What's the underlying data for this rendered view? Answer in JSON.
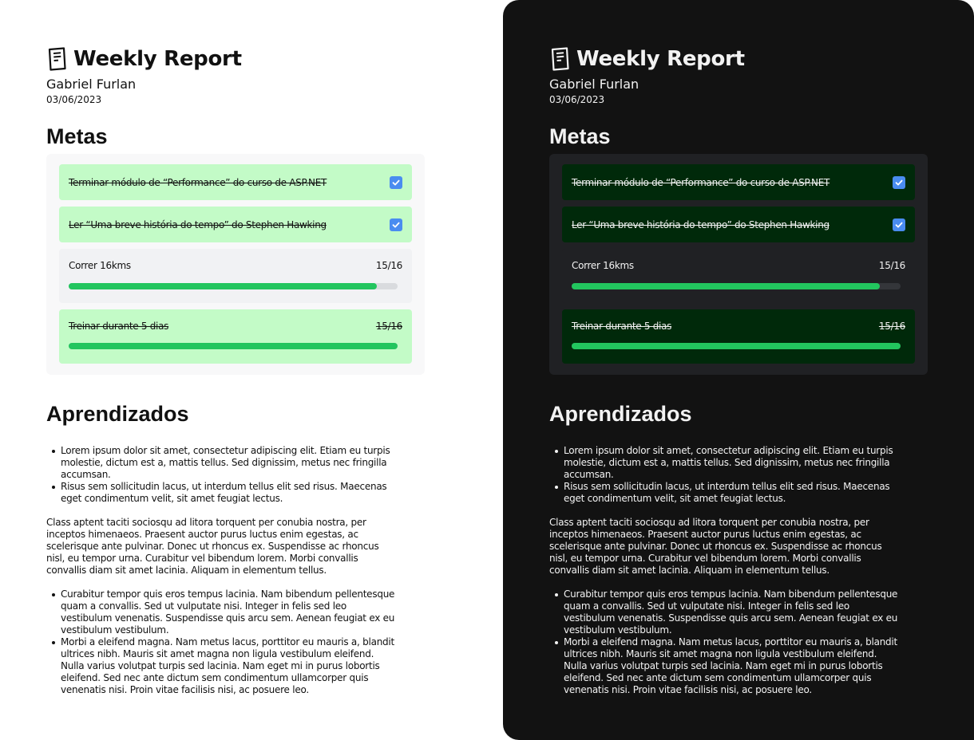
{
  "report": {
    "title": "Weekly Report",
    "author": "Gabriel Furlan",
    "date": "03/06/2023",
    "icon": "report-icon"
  },
  "metas": {
    "title": "Metas",
    "goals": [
      {
        "label": "Terminar módulo de “Performance” do curso de ASP.NET",
        "type": "checkbox",
        "checked": true,
        "done": true
      },
      {
        "label": "Ler “Uma breve história do tempo” do Stephen Hawking",
        "type": "checkbox",
        "checked": true,
        "done": true
      },
      {
        "label": "Correr 16kms",
        "type": "progress",
        "count": "15/16",
        "progress": 0.9375,
        "done": false
      },
      {
        "label": "Treinar durante 5 dias",
        "type": "progress",
        "count": "15/16",
        "progress": 1.0,
        "done": true
      }
    ]
  },
  "aprendizados": {
    "title": "Aprendizados",
    "list1": [
      "Lorem ipsum dolor sit amet, consectetur adipiscing elit. Etiam eu turpis molestie, dictum est a, mattis tellus. Sed dignissim, metus nec fringilla accumsan.",
      "Risus sem sollicitudin lacus, ut interdum tellus elit sed risus. Maecenas eget condimentum velit, sit amet feugiat lectus."
    ],
    "paragraph": "Class aptent taciti sociosqu ad litora torquent per conubia nostra, per inceptos himenaeos. Praesent auctor purus luctus enim egestas, ac scelerisque ante pulvinar. Donec ut rhoncus ex. Suspendisse ac rhoncus nisl, eu tempor urna. Curabitur vel bibendum lorem. Morbi convallis convallis diam sit amet lacinia. Aliquam in elementum tellus.",
    "list2": [
      "Curabitur tempor quis eros tempus lacinia. Nam bibendum pellentesque quam a convallis. Sed ut vulputate nisi. Integer in felis sed leo vestibulum venenatis. Suspendisse quis arcu sem. Aenean feugiat ex eu vestibulum vestibulum.",
      "Morbi a eleifend magna. Nam metus lacus, porttitor eu mauris a, blandit ultrices nibh. Mauris sit amet magna non ligula vestibulum eleifend. Nulla varius volutpat turpis sed lacinia. Nam eget mi in purus lobortis eleifend. Sed nec ante dictum sem condimentum ullamcorper quis venenatis nisi. Proin vitae facilisis nisi, ac posuere leo."
    ]
  },
  "colors": {
    "accent_green": "#22c55e",
    "done_light": "#c3fbc7",
    "done_dark": "#00290a",
    "checkbox_blue": "#4a8cf0",
    "dark_bg": "#121212"
  }
}
